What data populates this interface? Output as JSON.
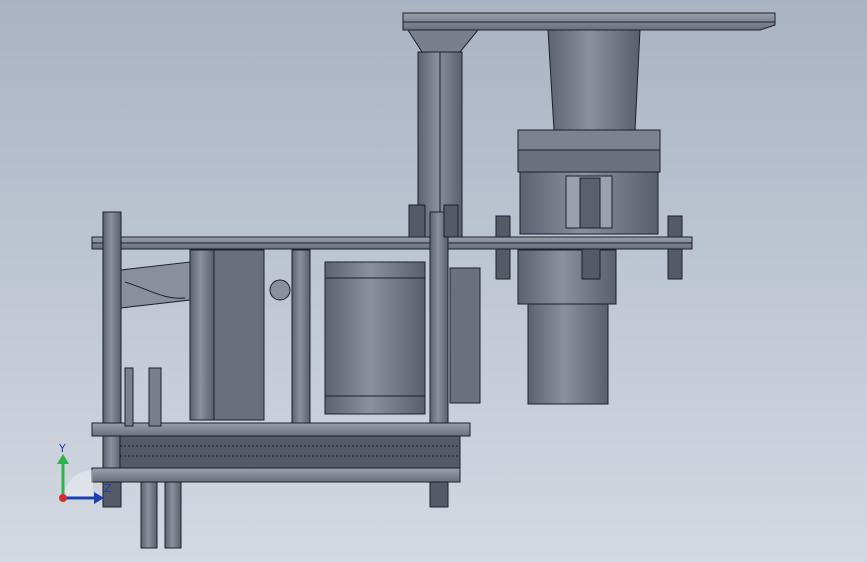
{
  "viewport": {
    "background_top": "#a9b3c2",
    "background_bottom": "#d3d9e2",
    "model_fill": "#6f7482",
    "model_fill_light": "#8a8f9c",
    "model_edge": "#1e2028"
  },
  "triad": {
    "y_label": "Y",
    "z_label": "Z",
    "y_color": "#2fb34a",
    "z_color": "#1b3fb0",
    "x_color": "#d42a2a",
    "icon": "coordinate-axes-icon"
  }
}
